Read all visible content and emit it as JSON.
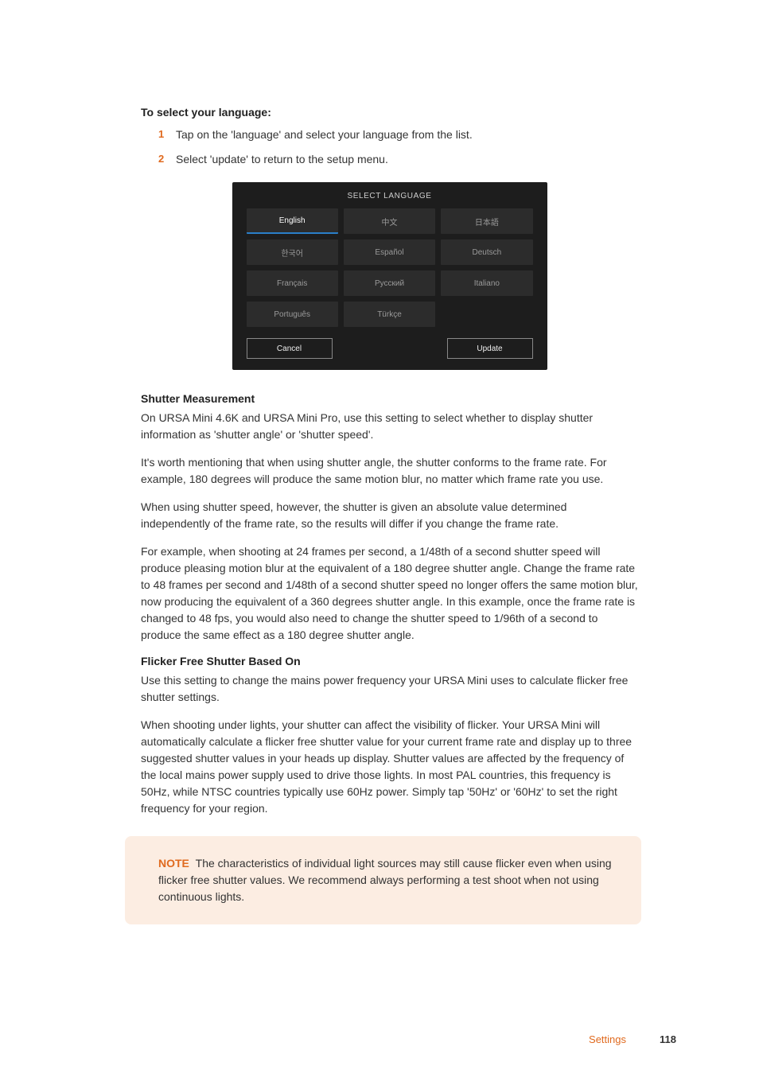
{
  "intro": {
    "heading": "To select your language:",
    "steps": [
      "Tap on the 'language' and select your language from the list.",
      "Select 'update' to return to the setup menu."
    ]
  },
  "langPanel": {
    "title": "SELECT LANGUAGE",
    "languages": [
      {
        "label": "English",
        "active": true
      },
      {
        "label": "中文",
        "active": false
      },
      {
        "label": "日本語",
        "active": false
      },
      {
        "label": "한국어",
        "active": false
      },
      {
        "label": "Español",
        "active": false
      },
      {
        "label": "Deutsch",
        "active": false
      },
      {
        "label": "Français",
        "active": false
      },
      {
        "label": "Русский",
        "active": false
      },
      {
        "label": "Italiano",
        "active": false
      },
      {
        "label": "Português",
        "active": false
      },
      {
        "label": "Türkçe",
        "active": false
      }
    ],
    "cancel": "Cancel",
    "update": "Update"
  },
  "shutter": {
    "heading": "Shutter Measurement",
    "p1": "On URSA Mini 4.6K and URSA Mini Pro, use this setting to select whether to display shutter information as 'shutter angle' or 'shutter speed'.",
    "p2": "It's worth mentioning that when using shutter angle, the shutter conforms to the frame rate. For example, 180 degrees will produce the same motion blur, no matter which frame rate you use.",
    "p3": "When using shutter speed, however, the shutter is given an absolute value determined independently of the frame rate, so the results will differ if you change the frame rate.",
    "p4": "For example, when shooting at 24 frames per second, a 1/48th of a second shutter speed will produce pleasing motion blur at the equivalent of a 180 degree shutter angle. Change the frame rate to 48 frames per second and 1/48th of a second shutter speed no longer offers the same motion blur, now producing the equivalent of a 360 degrees shutter angle. In this example, once the frame rate is changed to 48 fps, you would also need to change the shutter speed to 1/96th of a second to produce the same effect as a 180 degree shutter angle."
  },
  "flicker": {
    "heading": "Flicker Free Shutter Based On",
    "p1": "Use this setting to change the mains power frequency your URSA Mini uses to calculate flicker free shutter settings.",
    "p2": "When shooting under lights, your shutter can affect the visibility of flicker. Your URSA Mini will automatically calculate a flicker free shutter value for your current frame rate and display up to three suggested shutter values in your heads up display. Shutter values are affected by the frequency of the local mains power supply used to drive those lights. In most PAL countries, this frequency is 50Hz, while NTSC countries typically use 60Hz power. Simply tap '50Hz' or '60Hz' to set the right frequency for your region."
  },
  "note": {
    "label": "NOTE",
    "text": "The characteristics of individual light sources may still cause flicker even when using flicker free shutter values. We recommend always performing a test shoot when not using continuous lights."
  },
  "footer": {
    "section": "Settings",
    "page": "118"
  }
}
